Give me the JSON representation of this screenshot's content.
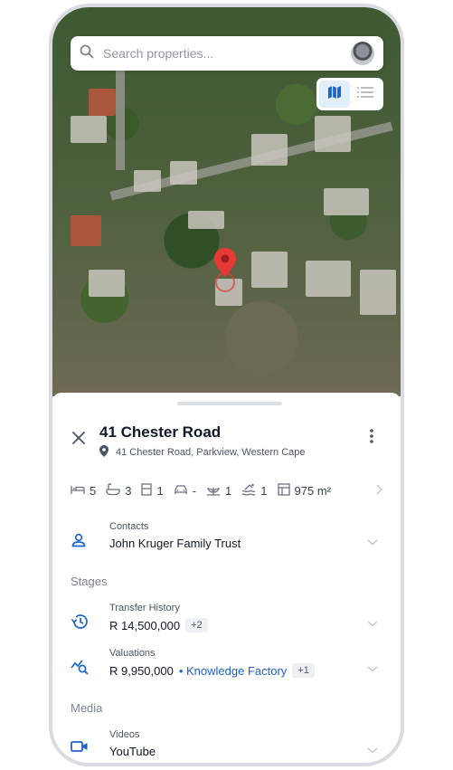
{
  "search": {
    "placeholder": "Search properties..."
  },
  "property": {
    "title": "41 Chester Road",
    "address": "41 Chester Road, Parkview, Western Cape"
  },
  "features": [
    {
      "icon": "bed-icon",
      "value": "5"
    },
    {
      "icon": "bath-icon",
      "value": "3"
    },
    {
      "icon": "door-icon",
      "value": "1"
    },
    {
      "icon": "car-icon",
      "value": "-"
    },
    {
      "icon": "garden-icon",
      "value": "1"
    },
    {
      "icon": "pool-icon",
      "value": "1"
    },
    {
      "icon": "floor-area-icon",
      "value": "975 m²"
    }
  ],
  "contacts": {
    "label": "Contacts",
    "value": "John Kruger Family Trust"
  },
  "stages": {
    "heading": "Stages",
    "transfer": {
      "label": "Transfer History",
      "value": "R 14,500,000",
      "chip": "+2"
    },
    "valuations": {
      "label": "Valuations",
      "value": "R 9,950,000",
      "source": "Knowledge Factory",
      "chip": "+1"
    }
  },
  "media": {
    "heading": "Media",
    "videos": {
      "label": "Videos",
      "value": "YouTube"
    }
  },
  "colors": {
    "accent": "#1e64c8",
    "pin": "#e53935"
  }
}
